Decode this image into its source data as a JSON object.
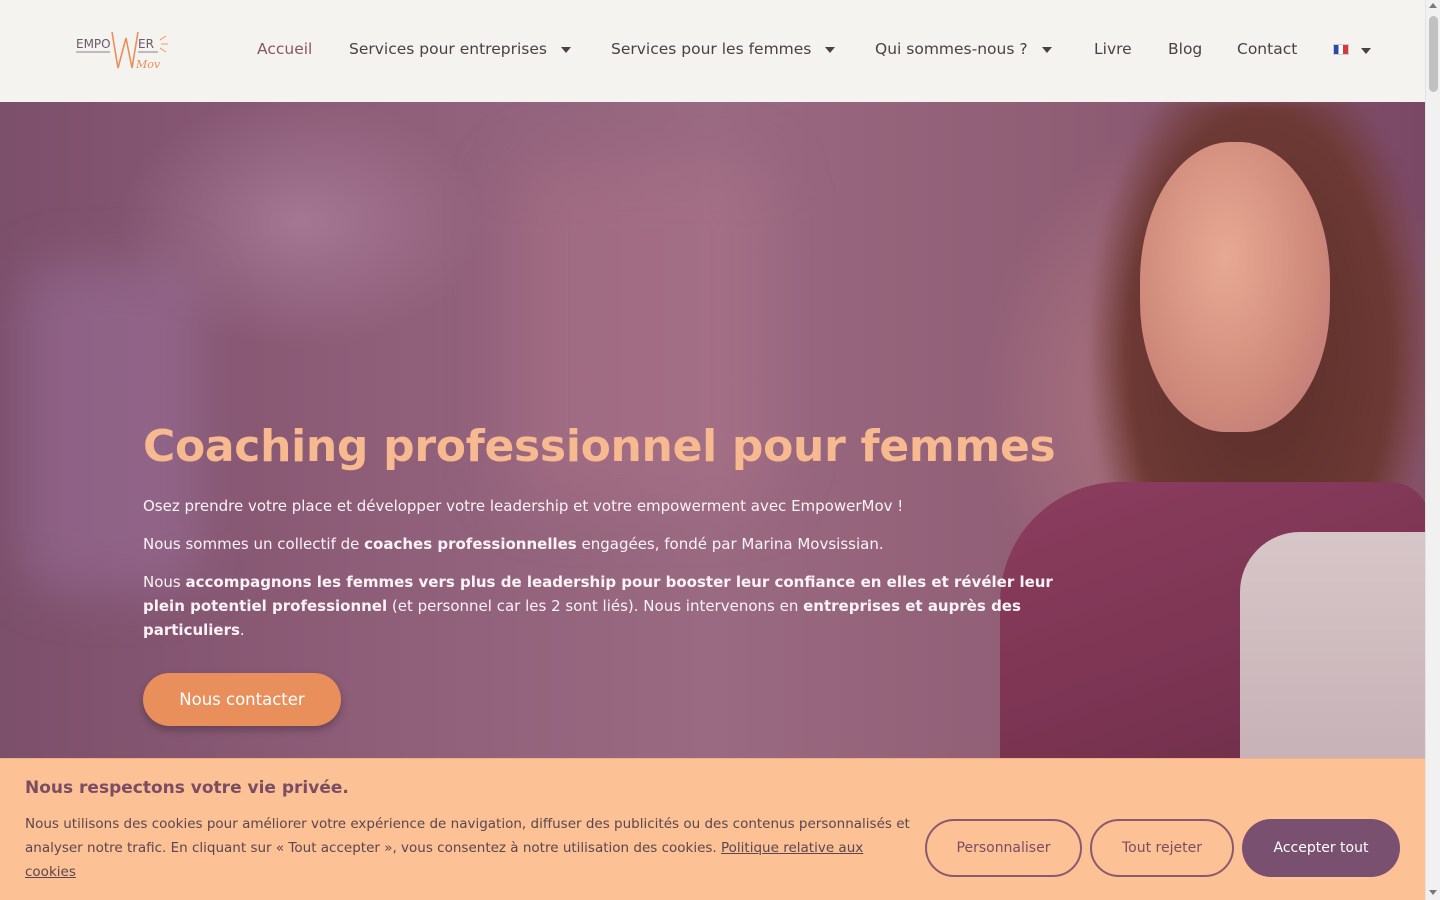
{
  "header": {
    "logo_alt": "EmpowerMov",
    "logo_text_a": "EMPO",
    "logo_text_b": "ER",
    "logo_text_c": "Mov",
    "nav": [
      {
        "label": "Accueil",
        "active": true,
        "dropdown": false
      },
      {
        "label": "Services pour entreprises",
        "dropdown": true
      },
      {
        "label": "Services pour les femmes",
        "dropdown": true
      },
      {
        "label": "Qui sommes-nous ?",
        "dropdown": true
      },
      {
        "label": "Livre",
        "dropdown": false
      },
      {
        "label": "Blog",
        "dropdown": false
      },
      {
        "label": "Contact",
        "dropdown": false
      }
    ],
    "language_icon": "flag-fr-icon"
  },
  "hero": {
    "title": "Coaching professionnel pour femmes",
    "p1": "Osez prendre votre place et développer votre leadership et votre empowerment avec EmpowerMov !",
    "p2_a": "Nous sommes un collectif de ",
    "p2_b": "coaches professionnelles",
    "p2_c": " engagées, fondé par Marina Movsissian.",
    "p3_a": "Nous ",
    "p3_b": "accompagnons les femmes vers plus de leadership pour booster leur confiance en elles et révéler leur plein potentiel professionnel",
    "p3_c": " (et personnel car les 2 sont liés). Nous intervenons en ",
    "p3_d": "entreprises et auprès des particuliers",
    "p3_e": ".",
    "cta_label": "Nous contacter"
  },
  "cookie_banner": {
    "title": "Nous respectons votre vie privée.",
    "text": "Nous utilisons des cookies pour améliorer votre expérience de navigation, diffuser des publicités ou des contenus personnalisés et analyser notre trafic. En cliquant sur « Tout accepter », vous consentez à notre utilisation des cookies.",
    "policy_link": "Politique relative aux cookies",
    "customize_label": "Personnaliser",
    "reject_label": "Tout rejeter",
    "accept_label": "Accepter tout"
  },
  "colors": {
    "accent": "#e98f5b",
    "title": "#f7b990",
    "cookie_bg": "#fcc195",
    "primary_dark": "#7a5070"
  }
}
